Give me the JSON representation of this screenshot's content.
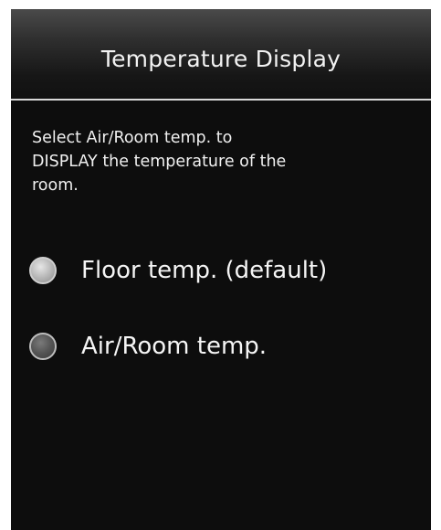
{
  "header": {
    "title": "Temperature Display"
  },
  "description": {
    "line1": "Select Air/Room temp. to",
    "line2": "DISPLAY the temperature of the",
    "line3": "room."
  },
  "options": [
    {
      "label": "Floor temp. (default)",
      "selected": true
    },
    {
      "label": "Air/Room temp.",
      "selected": false
    }
  ],
  "colors": {
    "screen_background": "#0d0d0d",
    "divider": "#d9d9d9",
    "text": "#f2f2f2"
  },
  "icons": {
    "radio_selected": "radio-selected-icon",
    "radio_unselected": "radio-unselected-icon"
  }
}
